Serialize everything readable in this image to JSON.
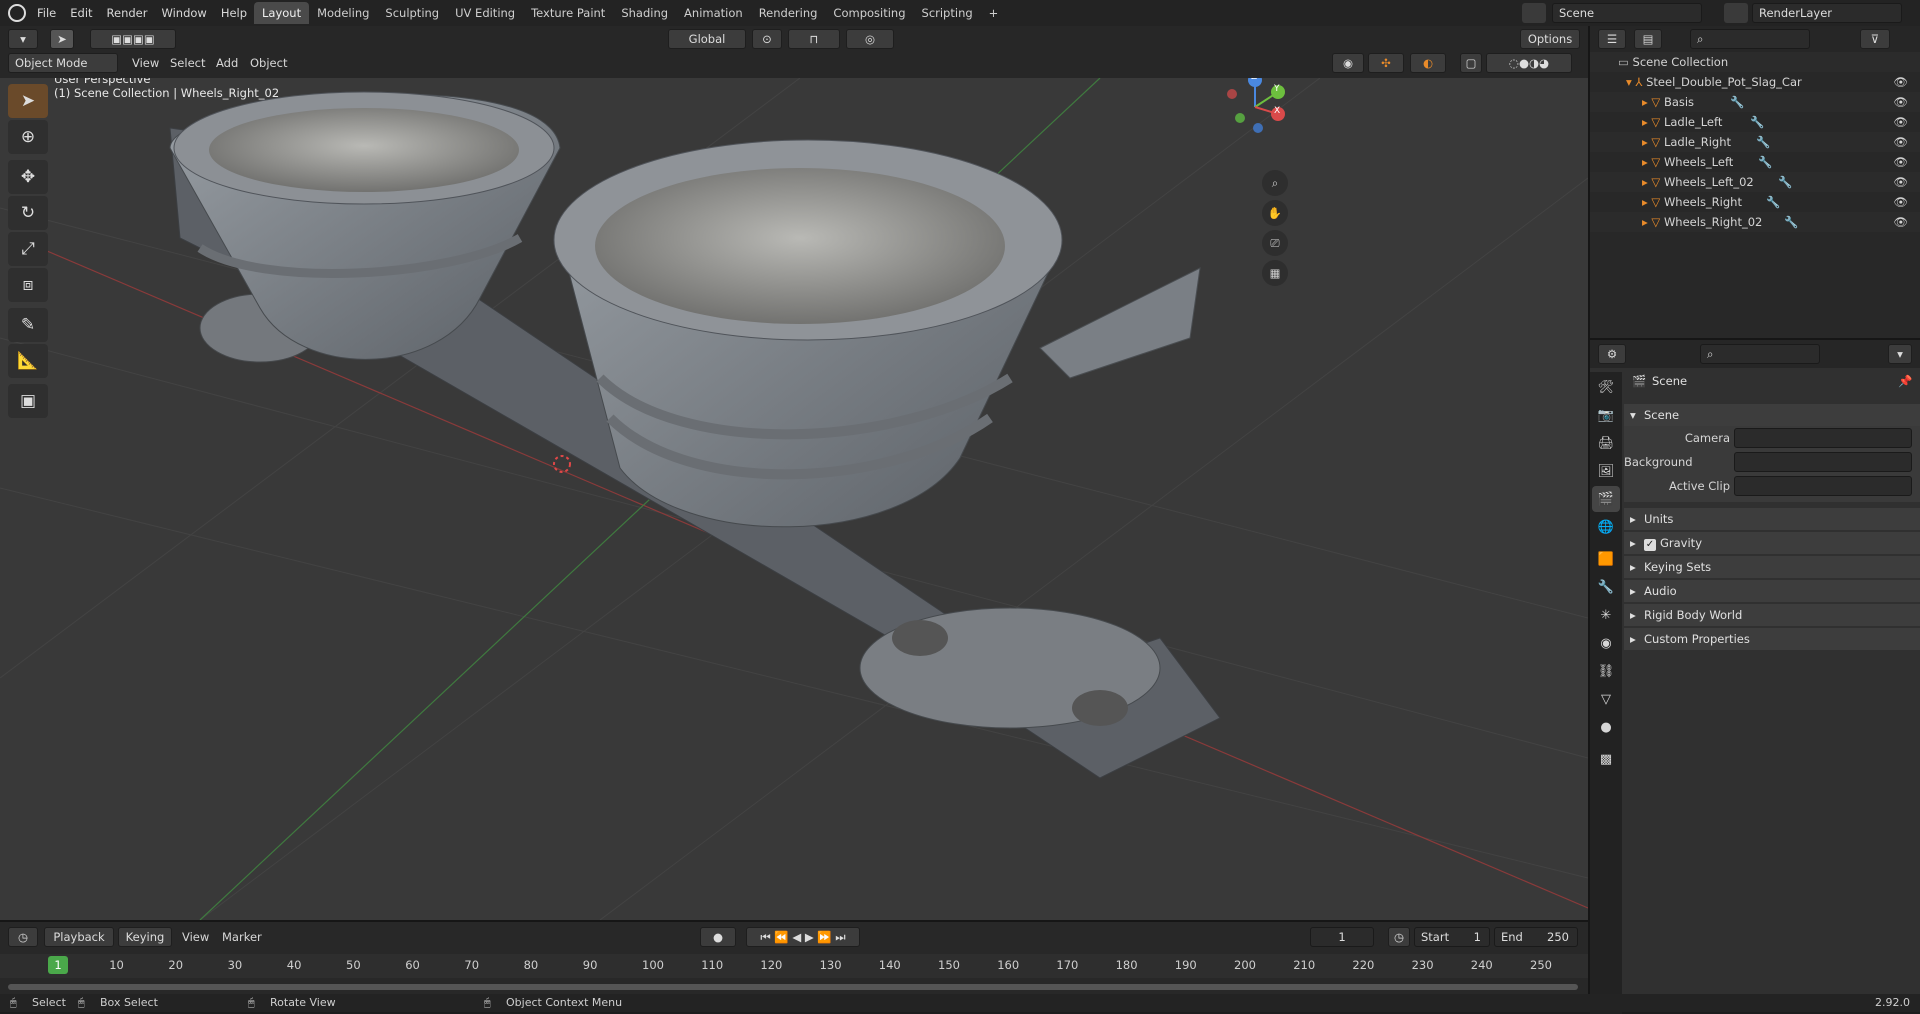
{
  "app": {
    "menus": [
      "File",
      "Edit",
      "Render",
      "Window",
      "Help"
    ],
    "workspaces": [
      "Layout",
      "Modeling",
      "Sculpting",
      "UV Editing",
      "Texture Paint",
      "Shading",
      "Animation",
      "Rendering",
      "Compositing",
      "Scripting"
    ],
    "active_workspace": "Layout",
    "add_workspace": "+",
    "scene_name": "Scene",
    "view_layer": "RenderLayer",
    "version": "2.92.0"
  },
  "viewport_header": {
    "transform_orientation": "Global",
    "options_label": "Options",
    "mode": "Object Mode",
    "menus": [
      "View",
      "Select",
      "Add",
      "Object"
    ]
  },
  "viewport": {
    "perspective_label": "User Perspective",
    "collection_label": "(1) Scene Collection | Wheels_Right_02",
    "gizmo_axes": [
      "Z",
      "Y",
      "X"
    ]
  },
  "outliner": {
    "root": "Scene Collection",
    "object": "Steel_Double_Pot_Slag_Car",
    "children": [
      "Basis",
      "Ladle_Left",
      "Ladle_Right",
      "Wheels_Left",
      "Wheels_Left_02",
      "Wheels_Right",
      "Wheels_Right_02"
    ]
  },
  "properties": {
    "context_title": "Scene",
    "panel": "Scene",
    "fields": [
      {
        "label": "Camera",
        "value": ""
      },
      {
        "label": "Background Scene",
        "value": ""
      },
      {
        "label": "Active Clip",
        "value": ""
      }
    ],
    "subpanels": [
      "Units",
      "Gravity",
      "Keying Sets",
      "Audio",
      "Rigid Body World",
      "Custom Properties"
    ],
    "gravity_checked": true
  },
  "timeline": {
    "menus": [
      "Playback",
      "Keying",
      "View",
      "Marker"
    ],
    "current_frame": "1",
    "start_label": "Start",
    "start": "1",
    "end_label": "End",
    "end": "250",
    "ruler": [
      "10",
      "20",
      "30",
      "40",
      "50",
      "60",
      "70",
      "80",
      "90",
      "100",
      "110",
      "120",
      "130",
      "140",
      "150",
      "160",
      "170",
      "180",
      "190",
      "200",
      "210",
      "220",
      "230",
      "240",
      "250"
    ],
    "playhead": "1"
  },
  "statusbar": {
    "select": "Select",
    "box_select": "Box Select",
    "rotate_view": "Rotate View",
    "context_menu": "Object Context Menu"
  },
  "colors": {
    "accent": "#e98b2a",
    "active_tab": "#4a4a4a",
    "x_axis": "#d94a4a",
    "y_axis": "#6dbf3e",
    "z_axis": "#4a88e0"
  }
}
